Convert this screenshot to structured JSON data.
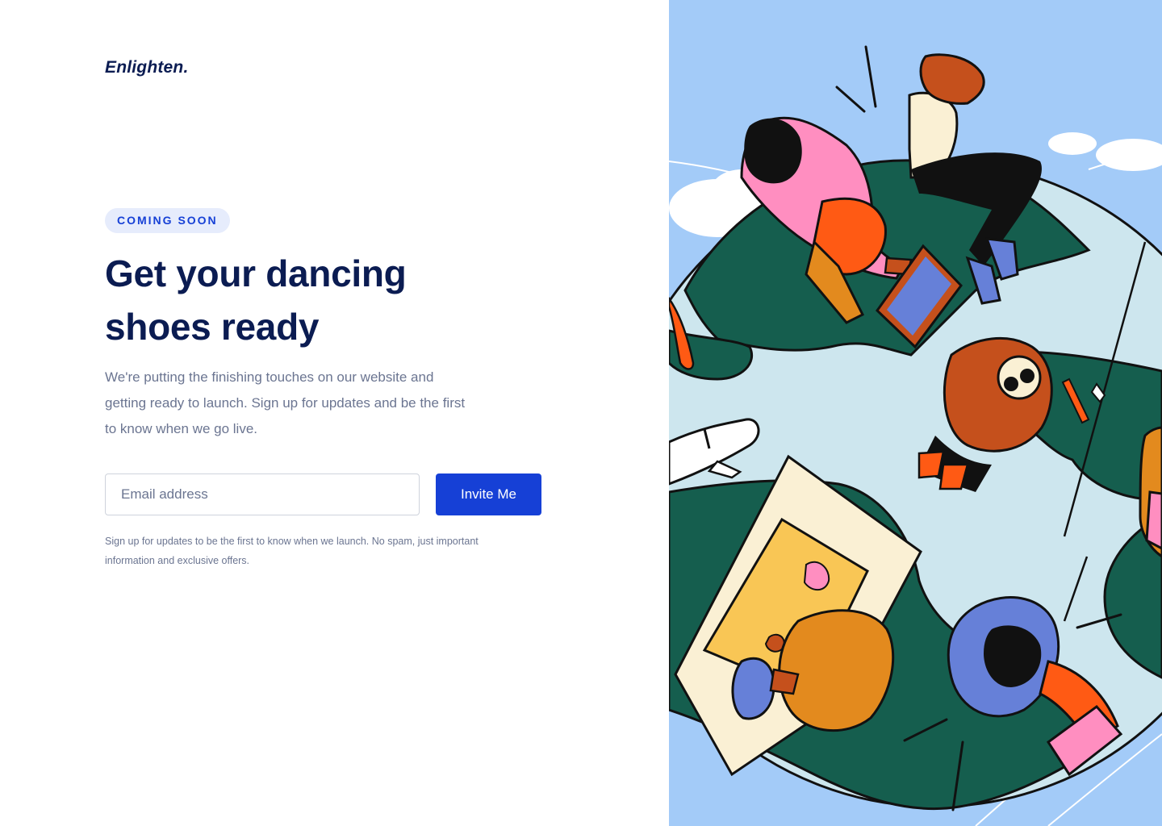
{
  "brand": {
    "logo_text": "Enlighten."
  },
  "hero": {
    "badge": "COMING SOON",
    "headline_line1": "Get your dancing",
    "headline_line2": "shoes ready",
    "description": "We're putting the finishing touches on our website and getting ready to launch. Sign up for updates and be the first to know when we go live."
  },
  "signup": {
    "email_placeholder": "Email address",
    "email_value": "",
    "submit_label": "Invite Me",
    "disclaimer": "Sign up for updates to be the first to know when we launch. No spam, just important information and exclusive offers."
  },
  "colors": {
    "navy": "#0b1c52",
    "accent_blue": "#1640d6",
    "badge_bg": "#e6ecfc",
    "muted_text": "#6b7591",
    "illustration_sky": "#a3cbf8",
    "illustration_green": "#155e4e",
    "illustration_pale": "#cde6ee"
  },
  "illustration": {
    "subject": "people-working-around-globe-illustration"
  }
}
